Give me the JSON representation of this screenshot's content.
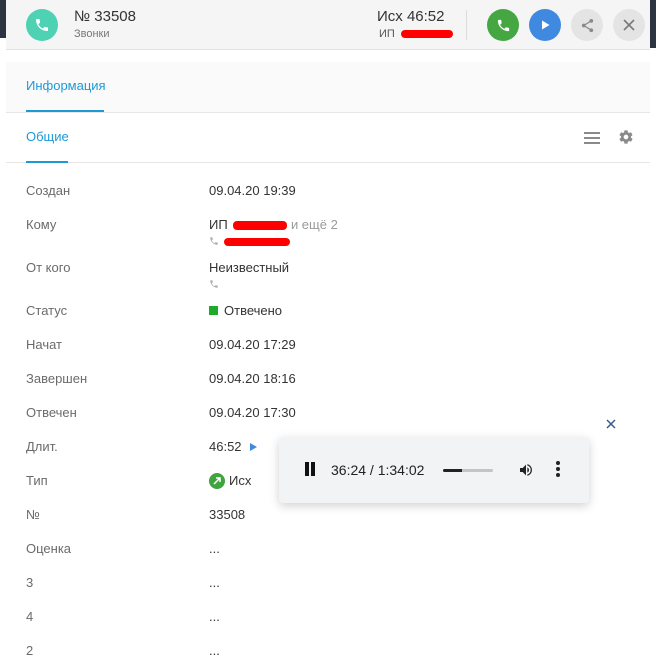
{
  "header": {
    "title": "№ 33508",
    "subtitle": "Звонки",
    "direction_time": "Исх  46:52",
    "counterparty_prefix": "ИП",
    "icon": "phone-icon",
    "buttons": [
      {
        "name": "call-button",
        "icon": "phone-icon",
        "color": "#44a742"
      },
      {
        "name": "play-button",
        "icon": "play-icon",
        "color": "#3f8ae0"
      },
      {
        "name": "share-button",
        "icon": "share-icon",
        "color": "#e4e4e4"
      },
      {
        "name": "close-button",
        "icon": "close-icon",
        "color": "#e4e4e4"
      }
    ]
  },
  "tabs": {
    "info": "Информация"
  },
  "section": {
    "title": "Общие",
    "menu_icon": "hamburger-icon",
    "settings_icon": "gear-icon"
  },
  "fields": {
    "created": {
      "label": "Создан",
      "value": "09.04.20 19:39"
    },
    "to": {
      "label": "Кому",
      "prefix": "ИП",
      "more": "и ещё 2"
    },
    "from": {
      "label": "От кого",
      "value": "Неизвестный"
    },
    "status": {
      "label": "Статус",
      "value": "Отвечено",
      "color": "#1faa2d"
    },
    "started": {
      "label": "Начат",
      "value": "09.04.20 17:29"
    },
    "finished": {
      "label": "Завершен",
      "value": "09.04.20 18:16"
    },
    "answered": {
      "label": "Отвечен",
      "value": "09.04.20 17:30"
    },
    "duration": {
      "label": "Длит.",
      "value": "46:52"
    },
    "type": {
      "label": "Тип",
      "value": "Исх"
    },
    "number": {
      "label": "№",
      "value": "33508"
    },
    "rating": {
      "label": "Оценка",
      "value": "..."
    },
    "f3": {
      "label": "3",
      "value": "..."
    },
    "f4": {
      "label": "4",
      "value": "..."
    },
    "f2": {
      "label": "2",
      "value": "..."
    }
  },
  "player": {
    "time": "36:24 / 1:34:02",
    "progress_fraction": 0.387,
    "pause_icon": "pause-icon",
    "volume_icon": "volume-icon",
    "more_icon": "more-vertical-icon"
  },
  "colors": {
    "accent": "#1d9ad6",
    "call_green": "#44a742",
    "play_blue": "#3f8ae0",
    "header_icon": "#4fd1b4"
  }
}
